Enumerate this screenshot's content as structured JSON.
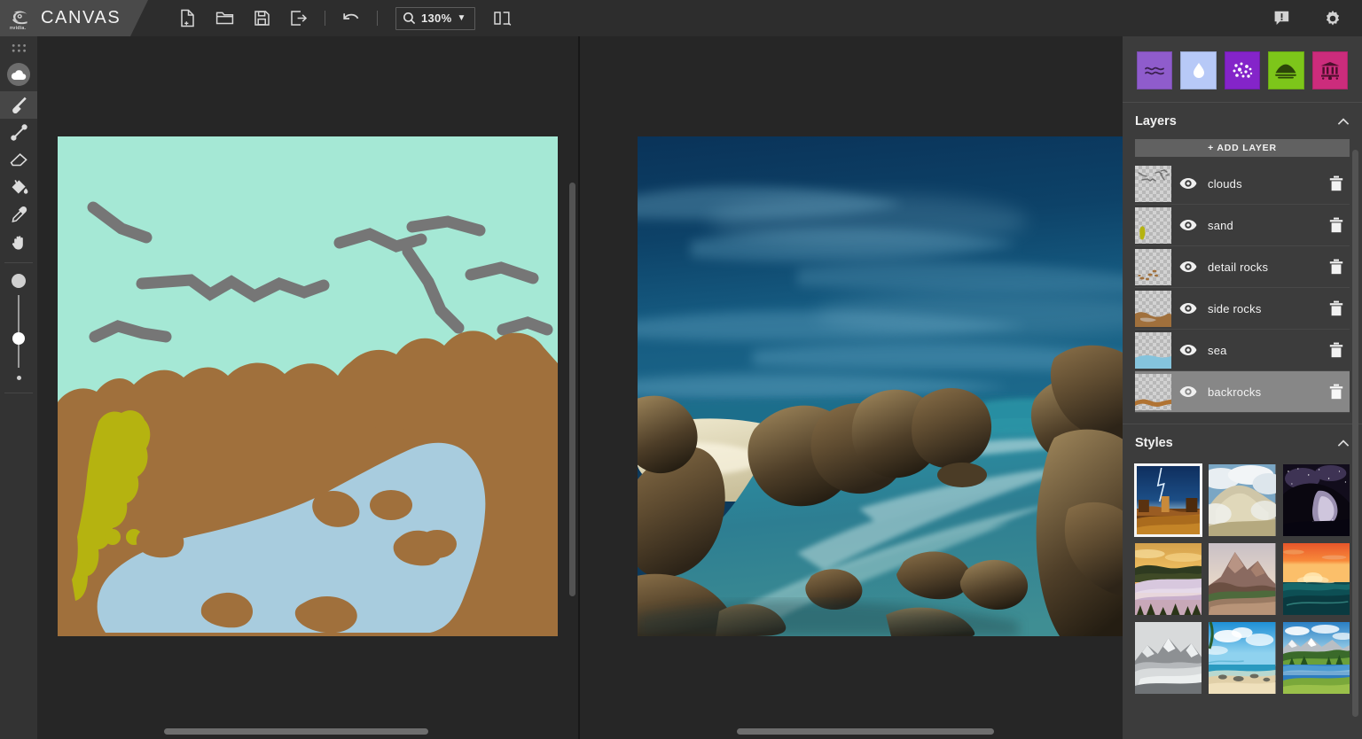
{
  "app": {
    "brand": "CANVAS",
    "logo_icon": "nvidia-logo"
  },
  "toolbar": {
    "items": [
      {
        "name": "new-file-button",
        "icon": "new-file-icon",
        "label": "New"
      },
      {
        "name": "open-file-button",
        "icon": "folder-open-icon",
        "label": "Open"
      },
      {
        "name": "save-button",
        "icon": "save-disk-icon",
        "label": "Save"
      },
      {
        "name": "export-button",
        "icon": "export-icon",
        "label": "Export"
      },
      {
        "name": "undo-button",
        "icon": "undo-arrow-icon",
        "label": "Undo"
      }
    ],
    "zoom": {
      "value": "130%",
      "icon": "magnifier-icon",
      "caret": "▼"
    },
    "view_layout_icon": "split-view-icon",
    "feedback_icon": "feedback-bubble-icon",
    "settings_icon": "gear-icon"
  },
  "left_toolbar": {
    "grip_icon": "drag-grip-icon",
    "material_selector": {
      "name": "material-picker",
      "icon": "cloud-icon"
    },
    "tools": [
      {
        "name": "brush-tool",
        "icon": "paintbrush-icon",
        "label": "Brush",
        "active": true
      },
      {
        "name": "line-tool",
        "icon": "line-icon",
        "label": "Line",
        "active": false
      },
      {
        "name": "eraser-tool",
        "icon": "eraser-icon",
        "label": "Eraser",
        "active": false
      },
      {
        "name": "fill-tool",
        "icon": "paint-bucket-icon",
        "label": "Fill",
        "active": false
      },
      {
        "name": "eyedropper-tool",
        "icon": "eyedropper-icon",
        "label": "Eyedropper",
        "active": false
      },
      {
        "name": "pan-tool",
        "icon": "hand-icon",
        "label": "Pan",
        "active": false
      }
    ],
    "brush_size": {
      "name": "brush-size-slider",
      "max_icon": "large-dot-icon",
      "min_icon": "small-dot-icon",
      "value_percent": 50
    }
  },
  "canvas": {
    "left_pane": {
      "name": "sketch-canvas",
      "sky_color": "#a5e8d5",
      "rock_color": "#a0703c",
      "sea_color": "#a8ccde",
      "sand_color": "#b5b310",
      "cloud_stroke_color": "#767676"
    },
    "right_pane": {
      "name": "rendered-output-canvas",
      "sky_top_color": "#0b3a63",
      "sky_bottom_color": "#16557e",
      "water_color": "#2d7f96",
      "rock_color": "#6b5436"
    },
    "scrollbars": {
      "left_vertical": "left-pane-vertical-scrollbar",
      "left_horizontal": "left-pane-horizontal-scrollbar",
      "right_vertical": "right-pane-vertical-scrollbar",
      "right_horizontal": "right-pane-horizontal-scrollbar"
    }
  },
  "right_panel": {
    "materials": [
      {
        "name": "material-water",
        "icon": "waves-icon",
        "color": "#8f5ccc",
        "glyph_color": "#3b2050",
        "selected": false
      },
      {
        "name": "material-snow",
        "icon": "water-drop-icon",
        "color": "#b7c9f7",
        "glyph_color": "#ffffff",
        "selected": false
      },
      {
        "name": "material-particles",
        "icon": "particles-icon",
        "color": "#8424c9",
        "glyph_color": "#ffffff",
        "selected": false
      },
      {
        "name": "material-hill",
        "icon": "hill-icon",
        "color": "#7dc61a",
        "glyph_color": "#2c4508",
        "selected": false
      },
      {
        "name": "material-ruins",
        "icon": "ruins-icon",
        "color": "#cc2c7c",
        "glyph_color": "#4d0f2c",
        "selected": false
      }
    ],
    "layers_section": {
      "title": "Layers",
      "collapse_icon": "chevron-up-icon",
      "add_layer_label": "+ ADD LAYER",
      "items": [
        {
          "name": "layer-clouds",
          "label": "clouds",
          "visible": true,
          "selected": false,
          "eye_icon": "eye-icon",
          "delete_icon": "trash-icon"
        },
        {
          "name": "layer-sand",
          "label": "sand",
          "visible": true,
          "selected": false,
          "eye_icon": "eye-icon",
          "delete_icon": "trash-icon"
        },
        {
          "name": "layer-detail-rocks",
          "label": "detail rocks",
          "visible": true,
          "selected": false,
          "eye_icon": "eye-icon",
          "delete_icon": "trash-icon"
        },
        {
          "name": "layer-side-rocks",
          "label": "side rocks",
          "visible": true,
          "selected": false,
          "eye_icon": "eye-icon",
          "delete_icon": "trash-icon"
        },
        {
          "name": "layer-sea",
          "label": "sea",
          "visible": true,
          "selected": false,
          "eye_icon": "eye-icon",
          "delete_icon": "trash-icon"
        },
        {
          "name": "layer-backrocks",
          "label": "backrocks",
          "visible": true,
          "selected": true,
          "eye_icon": "eye-icon",
          "delete_icon": "trash-icon"
        }
      ]
    },
    "styles_section": {
      "title": "Styles",
      "collapse_icon": "chevron-up-icon",
      "items": [
        {
          "name": "style-desert-lightning",
          "selected": true
        },
        {
          "name": "style-rocky-clouds",
          "selected": false
        },
        {
          "name": "style-night-cave",
          "selected": false
        },
        {
          "name": "style-golden-fog",
          "selected": false
        },
        {
          "name": "style-mountain-ridge",
          "selected": false
        },
        {
          "name": "style-orange-sunset-sea",
          "selected": false
        },
        {
          "name": "style-misty-bw-mountain",
          "selected": false
        },
        {
          "name": "style-tropical-beach",
          "selected": false
        },
        {
          "name": "style-alpine-lake",
          "selected": false
        }
      ]
    }
  }
}
